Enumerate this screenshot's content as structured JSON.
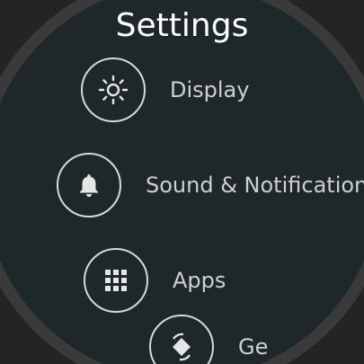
{
  "header": {
    "title": "Settings"
  },
  "menu": {
    "items": [
      {
        "label": "Display",
        "icon": "brightness-icon"
      },
      {
        "label": "Sound & Notification",
        "icon": "bell-icon"
      },
      {
        "label": "Apps",
        "icon": "apps-grid-icon"
      },
      {
        "label": "Ge",
        "icon": "screen-rotation-icon"
      }
    ]
  },
  "colors": {
    "background": "#242424",
    "face": "#1e282b",
    "bezel": "#3a3a3a",
    "title": "#ffffff",
    "label": "#cfcfcf",
    "icon": "#e6e6e6"
  }
}
